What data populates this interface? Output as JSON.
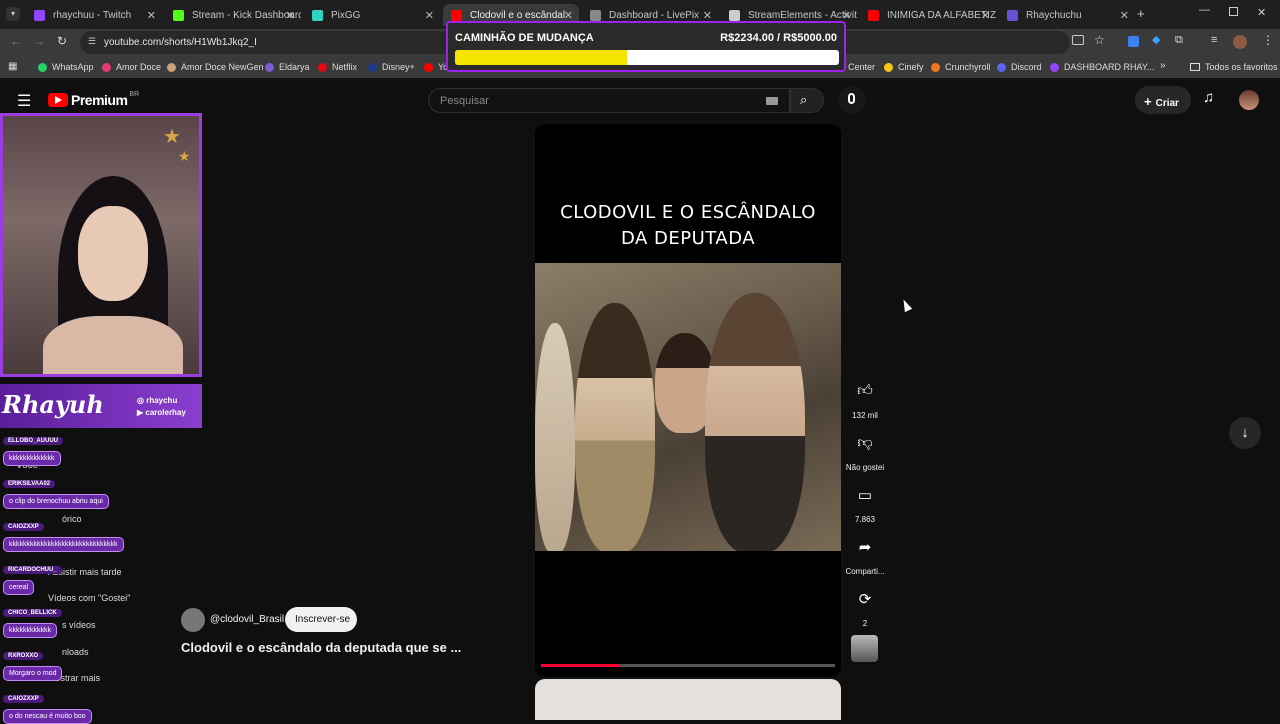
{
  "browser": {
    "tabs": [
      {
        "label": "rhaychuu - Twitch",
        "color": "#9146ff"
      },
      {
        "label": "Stream - Kick Dashboard",
        "color": "#53fc18"
      },
      {
        "label": "PixGG",
        "color": "#2dd4bf"
      },
      {
        "label": "Clodovil e o escândal",
        "color": "#ff0000"
      },
      {
        "label": "Dashboard - LivePix",
        "color": "#888888"
      },
      {
        "label": "StreamElements - Activity",
        "color": "#cccccc"
      },
      {
        "label": "INIMIGA DA ALFABETIZAÇ",
        "color": "#ff0000"
      },
      {
        "label": "Rhaychuchu",
        "color": "#6a4fd8"
      }
    ],
    "url": "youtube.com/shorts/H1Wb1Jkq2_I",
    "bookmarks": [
      "WhatsApp",
      "Amor Doce",
      "Amor Doce NewGen",
      "Eldarya",
      "Netflix",
      "Disney+",
      "Yo",
      "Center",
      "Cinefy",
      "Crunchyroll",
      "Discord",
      "DASHBOARD RHAY..."
    ],
    "bookmarks_all": "Todos os favoritos"
  },
  "goal": {
    "title": "CAMINHÃO DE MUDANÇA",
    "value_text": "R$2234.00 / R$5000.00",
    "fraction": 0.4468
  },
  "youtube": {
    "logo": "Premium",
    "region": "BR",
    "search_placeholder": "Pesquisar",
    "create_label": "Criar",
    "short": {
      "caption_line1": "CLODOVIL E O ESCÂNDALO",
      "caption_line2": "DA DEPUTADA",
      "progress": 0.27
    },
    "actions": {
      "likes": "132 mil",
      "dislike": "Não gostei",
      "comments": "7.863",
      "share": "Comparti...",
      "remix": "2"
    },
    "channel": "@clodovil_Brasil",
    "subscribe": "Inscrever-se",
    "title": "Clodovil e o escândalo da deputada que se ..."
  },
  "stream": {
    "brand_name": "Rhayuh",
    "handle1": "rhaychu",
    "handle2": "carolerhay",
    "sidebar_fragments": [
      "Você",
      "órico",
      "Assistir mais tarde",
      "Vídeos com \"Gostei\"",
      "s vídeos",
      "nloads",
      "Mostrar mais"
    ],
    "chat": [
      {
        "user": "ELLOBO_AUUUU",
        "msg": "kkkkkkkkkkkkk"
      },
      {
        "user": "ERIKSILVAA02",
        "msg": "o clip do brenochuu abriu aqui"
      },
      {
        "user": "CAIOZXXP",
        "msg": "kkkkkkkkkkkkkkkkkkkkkkkkkkkkkkk"
      },
      {
        "user": "RICARDOCHUU_",
        "msg": "cereal"
      },
      {
        "user": "CHICO_BELLICK",
        "msg": "kkkkkkkkkkkk"
      },
      {
        "user": "RXROXXO",
        "msg": "Morgaro o mod"
      },
      {
        "user": "CAIOZXXP",
        "msg": "o do nescau é muito boo"
      }
    ]
  }
}
